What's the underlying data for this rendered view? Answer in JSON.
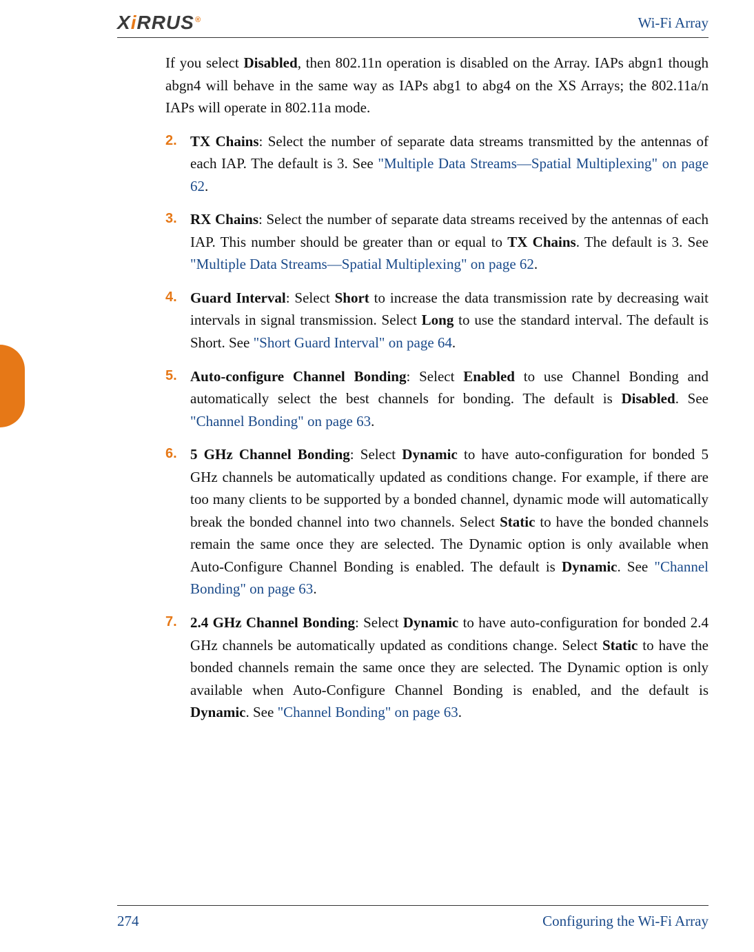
{
  "header": {
    "brand_left": "X",
    "brand_i": "i",
    "brand_right": "RRUS",
    "reg": "®",
    "right_label": "Wi-Fi Array"
  },
  "intro": {
    "t1": "If you select ",
    "b1": "Disabled",
    "t2": ", then 802.11n operation is disabled on the Array. IAPs abgn1 though abgn4 will behave in the same way as IAPs abg1 to abg4 on the XS Arrays; the 802.11a/n IAPs will operate in 802.11a mode."
  },
  "items": [
    {
      "num": "2.",
      "b1": "TX Chains",
      "t1": ": Select the number of separate data streams transmitted by the antennas of each IAP. The default is 3. See ",
      "l1": "\"Multiple Data Streams—Spatial Multiplexing\" on page 62",
      "t2": "."
    },
    {
      "num": "3.",
      "b1": "RX Chains",
      "t1": ": Select the number of separate data streams received by the antennas of each IAP. This number should be greater than or equal to ",
      "b2": "TX Chains",
      "t2": ". The default is 3. See ",
      "l1": "\"Multiple Data Streams—Spatial Multiplexing\" on page 62",
      "t3": "."
    },
    {
      "num": "4.",
      "b1": "Guard Interval",
      "t1": ": Select ",
      "b2": "Short",
      "t2": " to increase the data transmission rate by decreasing wait intervals in signal transmission. Select ",
      "b3": "Long",
      "t3": " to use the standard interval. The default is Short. See ",
      "l1": "\"Short Guard Interval\" on page 64",
      "t4": "."
    },
    {
      "num": "5.",
      "b1": "Auto-configure Channel Bonding",
      "t1": ": Select ",
      "b2": "Enabled",
      "t2": " to use Channel Bonding and automatically select the best channels for bonding. The default is ",
      "b3": "Disabled",
      "t3": ". See ",
      "l1": "\"Channel Bonding\" on page 63",
      "t4": "."
    },
    {
      "num": "6.",
      "b1": "5 GHz Channel Bonding",
      "t1": ": Select ",
      "b2": "Dynamic",
      "t2": " to have auto-configuration for bonded 5 GHz channels be automatically updated as conditions change. For example, if there are too many clients to be supported by a bonded channel, dynamic mode will automatically break the bonded channel into two channels. Select ",
      "b3": "Static",
      "t3": " to have the bonded channels remain the same once they are selected. The Dynamic option is only available when Auto-Configure Channel Bonding is enabled. The default is ",
      "b4": "Dynamic",
      "t4": ". See ",
      "l1": "\"Channel Bonding\" on page 63",
      "t5": "."
    },
    {
      "num": "7.",
      "b1": "2.4 GHz Channel Bonding",
      "t1": ": Select ",
      "b2": "Dynamic",
      "t2": " to have auto-configuration for bonded 2.4 GHz channels be automatically updated as conditions change. Select ",
      "b3": "Static",
      "t3": " to have the bonded channels remain the same once they are selected. The Dynamic option is only available when Auto-Configure Channel Bonding is enabled, and the default is ",
      "b4": "Dynamic",
      "t4": ". See ",
      "l1": "\"Channel Bonding\" on page 63",
      "t5": "."
    }
  ],
  "footer": {
    "page": "274",
    "section": "Configuring the Wi-Fi Array"
  }
}
